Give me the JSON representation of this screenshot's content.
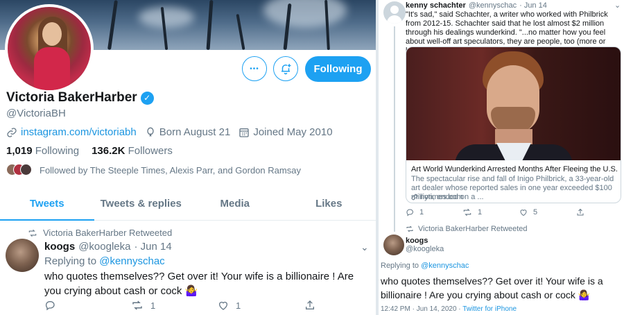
{
  "profile": {
    "name": "Victoria BakerHarber",
    "handle": "@VictoriaBH",
    "website": "instagram.com/victoriabh",
    "born": "Born August 21",
    "joined": "Joined May 2010",
    "following_count": "1,019",
    "following_label": "Following",
    "followers_count": "136.2K",
    "followers_label": "Followers",
    "followed_by": "Followed by The Steeple Times, Alexis Parr, and Gordon Ramsay",
    "follow_button": "Following",
    "more_button": "•••"
  },
  "tabs": [
    {
      "label": "Tweets",
      "active": true
    },
    {
      "label": "Tweets & replies",
      "active": false
    },
    {
      "label": "Media",
      "active": false
    },
    {
      "label": "Likes",
      "active": false
    }
  ],
  "left_tweet": {
    "retweeted_by": "Victoria BakerHarber Retweeted",
    "author_name": "koogs",
    "author_handle": "@koogleka",
    "date": "· Jun 14",
    "replying_prefix": "Replying to ",
    "replying_to": "@kennyschac",
    "text": "who quotes themselves?? Get over it! Your wife is a billionaire ! Are you crying about cash or cock 🤷‍♀️",
    "retweets": "1",
    "likes": "1"
  },
  "right_parent": {
    "author_name": "kenny schachter",
    "author_handle": "@kennyschac",
    "date": "· Jun 14",
    "text": "\"It's sad,\" said Schachter, a writer who worked with Philbrick from 2012-15. Schachter said that he lost almost $2 million through his dealings wunderkind. \"...no matter how you feel about well-off art speculators, they are people, too (more or less),\"",
    "card_title": "Art World Wunderkind Arrested Months After Fleeing the U.S.",
    "card_desc": "The spectacular rise and fall of Inigo Philbrick, a 33-year-old art dealer whose reported sales in one year exceeded $100 million, ended on a ...",
    "card_domain": "nytimes.com",
    "replies": "1",
    "retweets": "1",
    "likes": "5"
  },
  "right_reply": {
    "retweeted_by": "Victoria BakerHarber Retweeted",
    "author_name": "koogs",
    "author_handle": "@koogleka",
    "replying_prefix": "Replying to ",
    "replying_to": "@kennyschac",
    "text": "who quotes themselves?? Get over it! Your wife is a billionaire ! Are you crying about cash or cock 🤷‍♀️",
    "timestamp": "12:42 PM · Jun 14, 2020 · ",
    "source": "Twitter for iPhone"
  },
  "colors": {
    "accent": "#1da1f2",
    "link": "#1b95e0",
    "muted": "#657786",
    "text": "#14171a"
  }
}
